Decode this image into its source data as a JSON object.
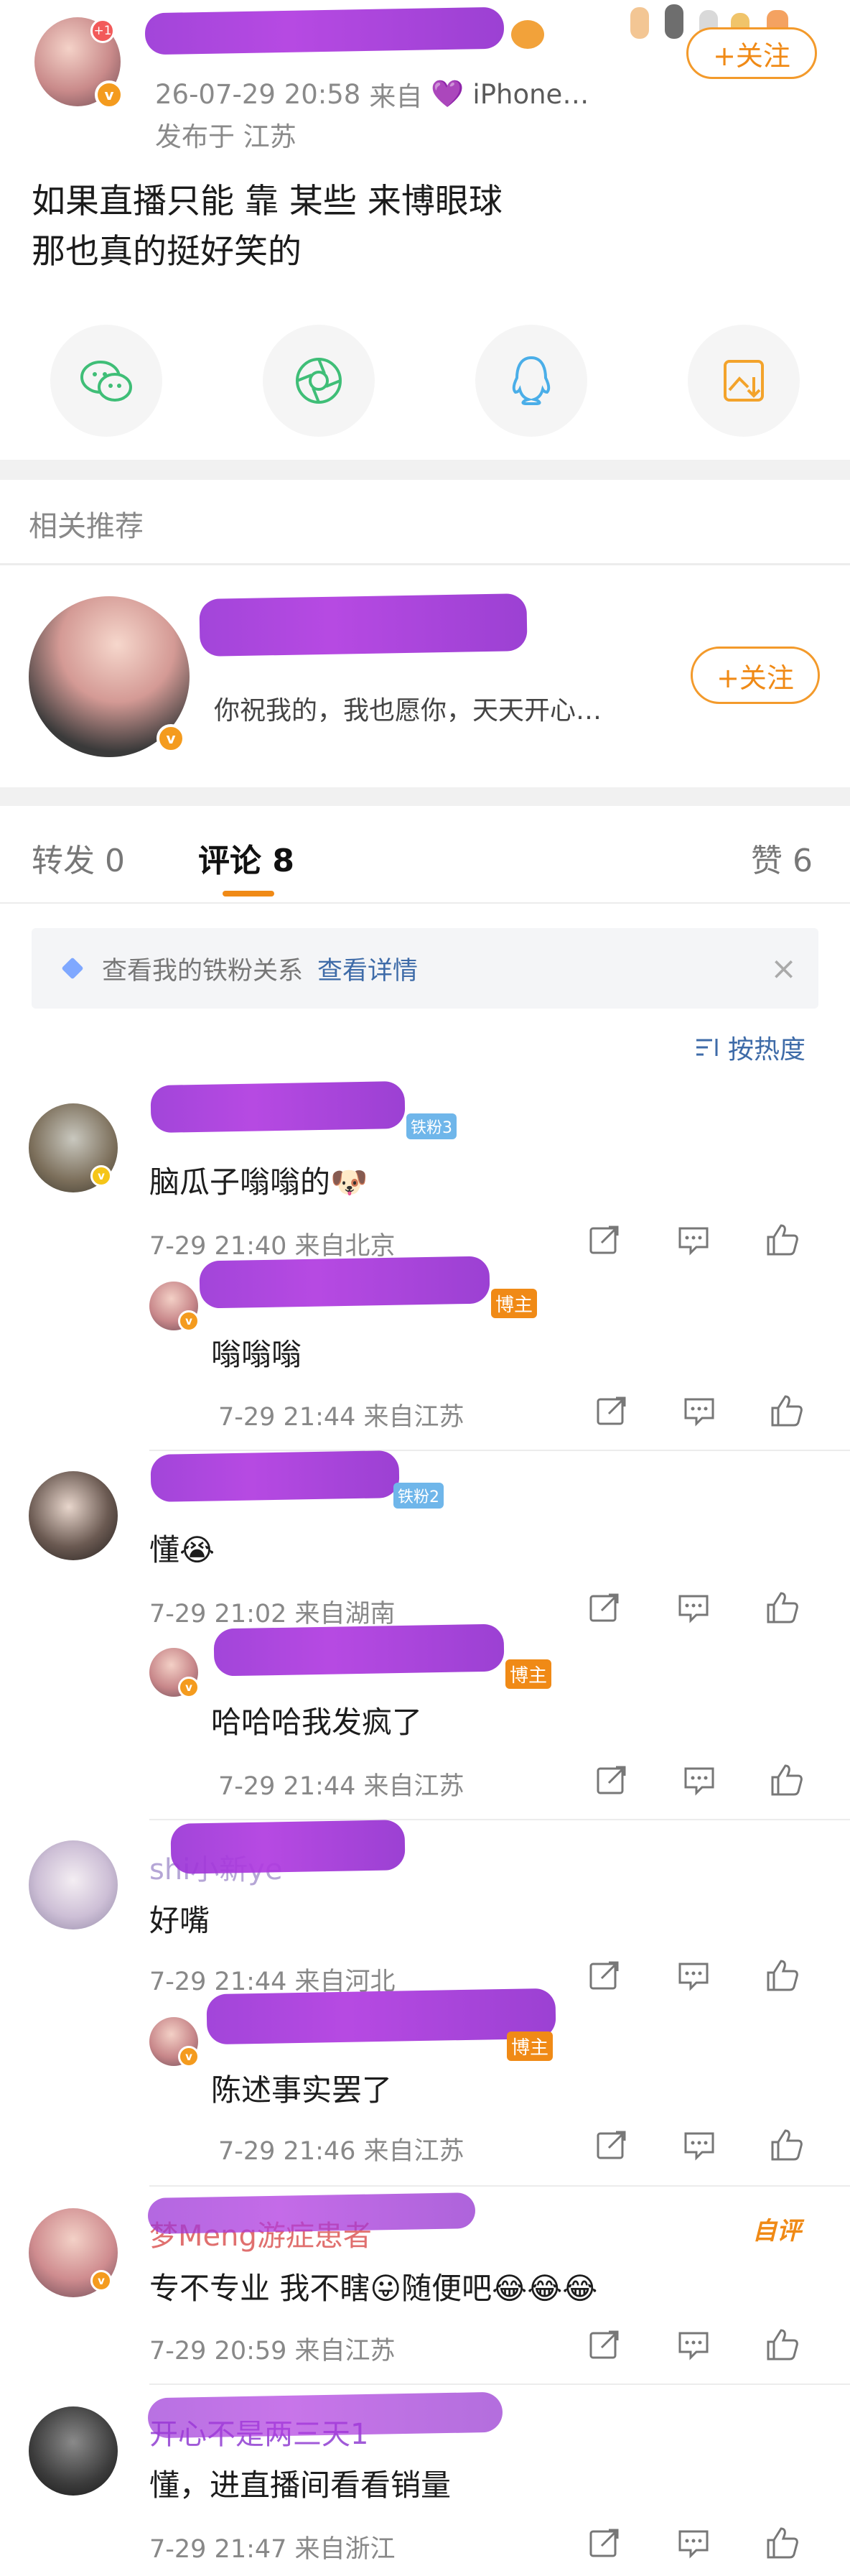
{
  "post": {
    "timestamp": "26-07-29 20:58",
    "source_prefix": "来自",
    "source_device": "iPhone…",
    "location": "发布于 江苏",
    "body_line1": "如果直播只能 靠 某些 来博眼球",
    "body_line2": "那也真的挺好笑的",
    "follow_label": "+关注",
    "badge_count": "+1"
  },
  "share": {
    "icons": [
      "wechat-icon",
      "moments-icon",
      "qq-icon",
      "save-image-icon"
    ]
  },
  "related": {
    "heading": "相关推荐",
    "bio": "你祝我的，我也愿你，天天开心…",
    "follow_label": "+关注"
  },
  "tabs": {
    "repost": "转发 0",
    "comments": "评论 8",
    "likes": "赞 6"
  },
  "fan_banner": {
    "text": "查看我的铁粉关系",
    "link": "查看详情"
  },
  "sort": {
    "label": "按热度"
  },
  "comments": [
    {
      "fan_tag": "铁粉3",
      "text": "脑瓜子嗡嗡的🐶",
      "time": "7-29 21:40 来自北京",
      "reply": {
        "tag": "博主",
        "text": "嗡嗡嗡",
        "time": "7-29 21:44 来自江苏"
      }
    },
    {
      "fan_tag": "铁粉2",
      "text": "懂😭",
      "time": "7-29 21:02 来自湖南",
      "reply": {
        "tag": "博主",
        "text": "哈哈哈我发疯了",
        "time": "7-29 21:44 来自江苏"
      }
    },
    {
      "name_visible": "shi小新ye",
      "text": "好嘴",
      "time": "7-29 21:44 来自河北",
      "reply": {
        "tag": "博主",
        "text": "陈述事实罢了",
        "time": "7-29 21:46 来自江苏"
      }
    },
    {
      "name_visible": "梦Meng游症患者",
      "badge": "自评",
      "text": "专不专业 我不瞎😛随便吧😂😂😂",
      "time": "7-29 20:59 来自江苏"
    },
    {
      "name_visible": "开心不是两三天1",
      "text": "懂，进直播间看看销量",
      "time": "7-29 21:47 来自浙江"
    }
  ],
  "colors": {
    "accent": "#f08a16",
    "link": "#3e6ba8",
    "redaction": "#a236d8",
    "divider": "#f1f1f1"
  }
}
